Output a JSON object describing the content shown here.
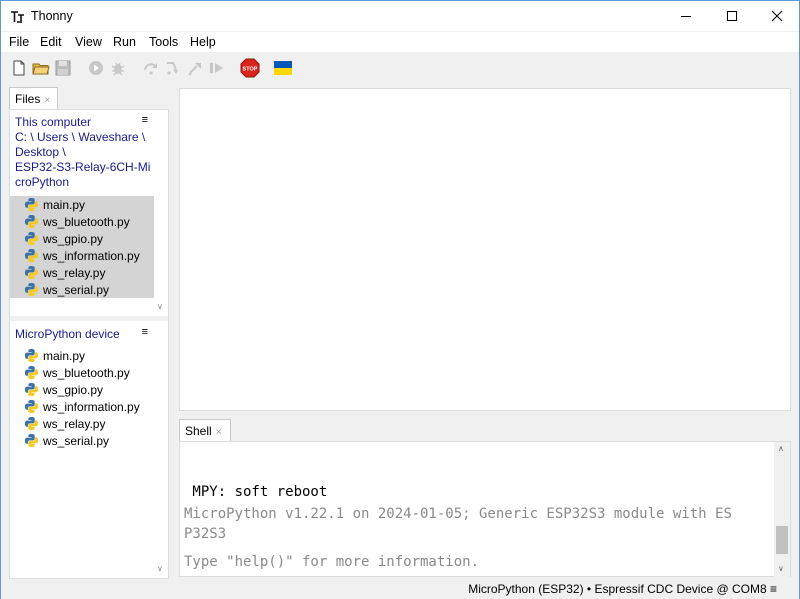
{
  "window": {
    "title": "Thonny"
  },
  "menu": [
    "File",
    "Edit",
    "View",
    "Run",
    "Tools",
    "Help"
  ],
  "toolbar": {
    "icons": [
      "new-file-icon",
      "open-file-icon",
      "save-icon",
      "run-icon",
      "debug-icon",
      "step-over-icon",
      "step-into-icon",
      "step-out-icon",
      "resume-icon",
      "stop-icon",
      "flag-icon"
    ],
    "stop_label": "STOP"
  },
  "files_tab": {
    "label": "Files",
    "close": "×"
  },
  "this_computer": {
    "title": "This computer",
    "menu_glyph": "≡",
    "path_lines": [
      "C: \\ Users \\ Waveshare \\",
      " Desktop \\",
      "ESP32-S3-Relay-6CH-Mi",
      "croPython"
    ],
    "files": [
      "main.py",
      "ws_bluetooth.py",
      "ws_gpio.py",
      "ws_information.py",
      "ws_relay.py",
      "ws_serial.py"
    ]
  },
  "device": {
    "title": "MicroPython device",
    "menu_glyph": "≡",
    "files": [
      "main.py",
      "ws_bluetooth.py",
      "ws_gpio.py",
      "ws_information.py",
      "ws_relay.py",
      "ws_serial.py"
    ]
  },
  "shell_tab": {
    "label": "Shell",
    "close": "×"
  },
  "shell": {
    "lines": [
      " MPY: soft reboot",
      "MicroPython v1.22.1 on 2024-01-05; Generic ESP32S3 module with ES",
      "P32S3",
      "Type \"help()\" for more information."
    ]
  },
  "status": {
    "text": "MicroPython (ESP32)  •  Espressif CDC Device @ COM8  ≡"
  },
  "colors": {
    "link": "#1a1a8c",
    "selection": "#d4d4d4",
    "stop": "#d9251c",
    "flag_blue": "#0057b7",
    "flag_yellow": "#ffd700"
  }
}
